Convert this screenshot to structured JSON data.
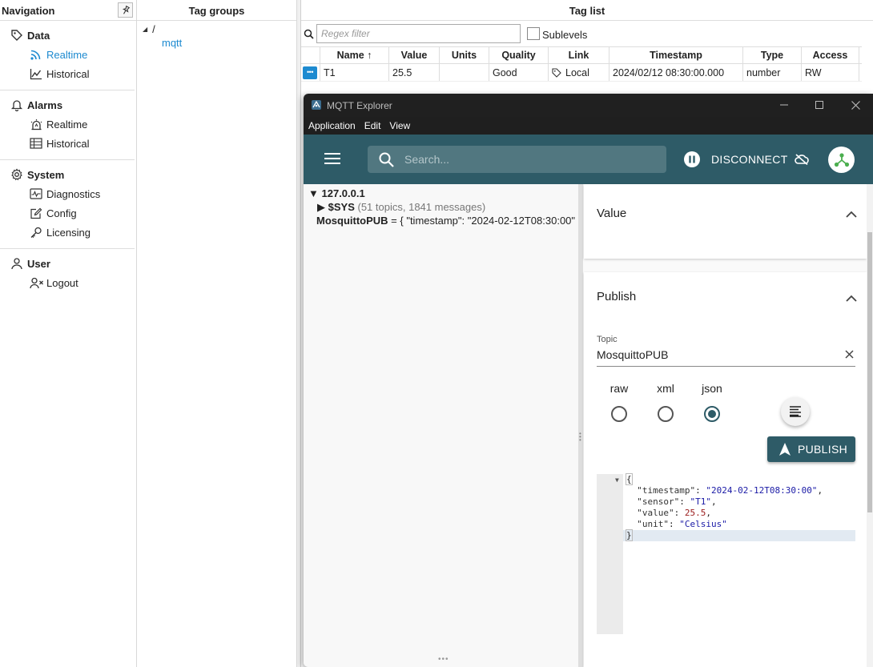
{
  "nav": {
    "title": "Navigation",
    "sections": [
      {
        "title": "Data",
        "items": [
          "Realtime",
          "Historical"
        ]
      },
      {
        "title": "Alarms",
        "items": [
          "Realtime",
          "Historical"
        ]
      },
      {
        "title": "System",
        "items": [
          "Diagnostics",
          "Config",
          "Licensing"
        ]
      },
      {
        "title": "User",
        "items": [
          "Logout"
        ]
      }
    ],
    "accent": "#1d8ad0"
  },
  "groups": {
    "title": "Tag groups",
    "root": "/",
    "child": "mqtt"
  },
  "taglist": {
    "title": "Tag list",
    "filter_placeholder": "Regex filter",
    "sublevels_label": "Sublevels",
    "columns": [
      "Name ↑",
      "Value",
      "Units",
      "Quality",
      "Link",
      "Timestamp",
      "Type",
      "Access"
    ],
    "rows": [
      {
        "name": "T1",
        "value": "25.5",
        "units": "",
        "quality": "Good",
        "link": "Local",
        "timestamp": "2024/02/12 08:30:00.000",
        "type": "number",
        "access": "RW"
      }
    ]
  },
  "mqtt": {
    "window_title": "MQTT Explorer",
    "menu": [
      "Application",
      "Edit",
      "View"
    ],
    "search_placeholder": "Search...",
    "disconnect_label": "DISCONNECT",
    "appbar_color": "#2e5b67",
    "tree": {
      "host": "127.0.0.1",
      "sys_label": "$SYS",
      "sys_meta": "(51 topics, 1841 messages)",
      "topic_label": "MosquittoPUB",
      "topic_value": "= { \"timestamp\": \"2024-02-12T08:30:00\""
    },
    "value_title": "Value",
    "publish": {
      "title": "Publish",
      "topic_label": "Topic",
      "topic_value": "MosquittoPUB",
      "formats": [
        "raw",
        "xml",
        "json"
      ],
      "selected_format": "json",
      "publish_label": "PUBLISH",
      "code": {
        "open": "{",
        "k1": "\"timestamp\"",
        "v1": "\"2024-02-12T08:30:00\"",
        "k2": "\"sensor\"",
        "v2": "\"T1\"",
        "k3": "\"value\"",
        "v3": "25.5",
        "k4": "\"unit\"",
        "v4": "\"Celsius\"",
        "close": "}"
      }
    }
  }
}
